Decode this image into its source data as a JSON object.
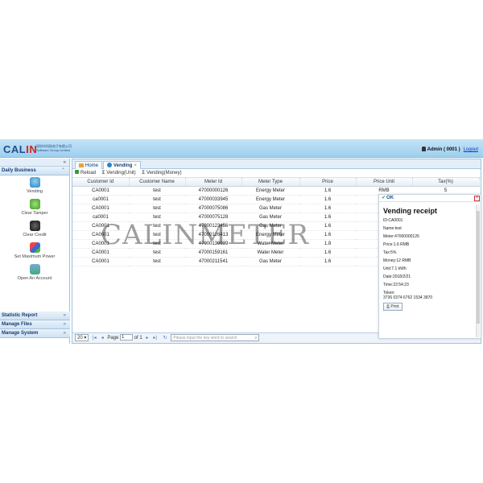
{
  "header": {
    "logo_main": "CAL",
    "logo_accent": "IN",
    "logo_sub_line1": "深圳市科陆电子有限公司",
    "logo_sub_line2": "Software Group Limited",
    "user_text": "Admin ( 0001 )",
    "logout_label": "Logout"
  },
  "sidebar": {
    "collapse_glyph": "«",
    "daily_business": {
      "title": "Daily Business",
      "chevron": "⌃",
      "items": [
        {
          "label": "Vending",
          "icon": "vending-icon"
        },
        {
          "label": "Clear Tamper",
          "icon": "clear-tamper-icon"
        },
        {
          "label": "Clear Credit",
          "icon": "clear-credit-icon"
        },
        {
          "label": "Set Maximum Power",
          "icon": "set-max-power-icon"
        },
        {
          "label": "Open An Account",
          "icon": "open-account-icon"
        }
      ]
    },
    "sections": [
      {
        "label": "Statistic Report",
        "chevron": "»"
      },
      {
        "label": "Manage Files",
        "chevron": "»"
      },
      {
        "label": "Manage System",
        "chevron": "»"
      }
    ]
  },
  "tabs": [
    {
      "label": "Home",
      "icon": "home-icon"
    },
    {
      "label": "Vending",
      "icon": "vending-icon",
      "close": "×"
    }
  ],
  "toolbar": {
    "reload": "Reload",
    "vending_unit": "Vending(Unit)",
    "vending_money": "Vending(Money)",
    "sigma": "Σ"
  },
  "table": {
    "columns": [
      "Customer Id",
      "Customer Name",
      "Meter Id",
      "Meter Type",
      "Price",
      "Price Unit",
      "Tax(%)"
    ],
    "rows": [
      [
        "CA0001",
        "test",
        "47000000126",
        "Energy Meter",
        "1.6",
        "RMB",
        "5"
      ],
      [
        "ca0001",
        "test",
        "47000033945",
        "Energy Meter",
        "1.6",
        "",
        ""
      ],
      [
        "CA0001",
        "test",
        "47000075086",
        "Gas Meter",
        "1.6",
        "",
        ""
      ],
      [
        "ca0001",
        "test",
        "47000075128",
        "Gas Meter",
        "1.6",
        "",
        ""
      ],
      [
        "CA0001",
        "test",
        "47000123456",
        "Gas Meter",
        "1.6",
        "",
        ""
      ],
      [
        "CA0001",
        "test",
        "47000126413",
        "Energy Meter",
        "1.6",
        "",
        ""
      ],
      [
        "CA0001",
        "test",
        "47000139939",
        "Water Meter",
        "1.8",
        "",
        ""
      ],
      [
        "CA0001",
        "test",
        "47000159161",
        "Water Meter",
        "1.6",
        "",
        ""
      ],
      [
        "CA0001",
        "test",
        "47000211541",
        "Gas Meter",
        "1.6",
        "",
        ""
      ]
    ]
  },
  "pager": {
    "page_size": "20",
    "page_label": "Page",
    "page_value": "1",
    "of_label": "of 1",
    "search_placeholder": "Please input the key word to search"
  },
  "receipt": {
    "ok_label": "OK",
    "close_glyph": "×",
    "title": "Vending receipt",
    "lines": [
      "ID:CA0001",
      "Name:test",
      "Meter:47000000126",
      "Price:1.6 RMB",
      "Tax:5%",
      "Money:12 RMB",
      "Unit:7.1 kWh",
      "Date:2018/2/21",
      "Time:22:54:23"
    ],
    "token_label": "Token:",
    "token_value": "3736 0374 6762 1534 3870",
    "print_label": "Print"
  },
  "watermark": "CALINMETER",
  "colors": {
    "header_bg": "#9ecfee",
    "brand_blue": "#1e4f8a",
    "brand_red": "#d22222"
  }
}
